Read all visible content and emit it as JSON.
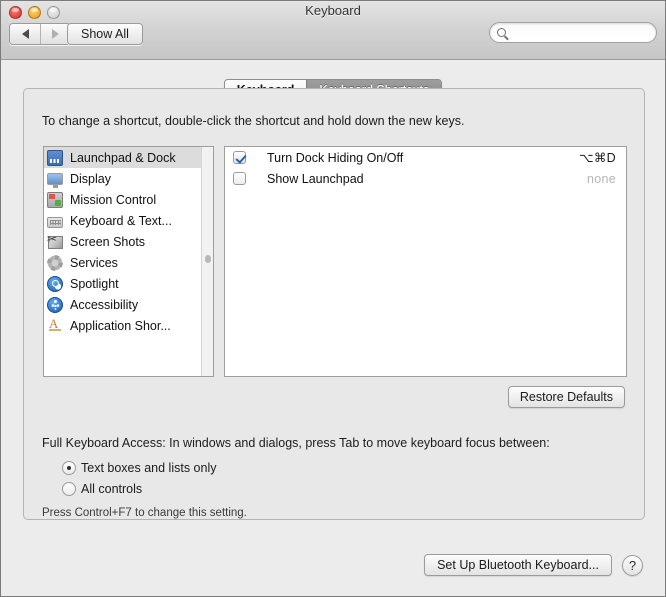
{
  "window": {
    "title": "Keyboard",
    "traffic_lights": [
      "close",
      "minimize",
      "zoom"
    ]
  },
  "toolbar": {
    "back_label": "◀",
    "forward_label": "▶",
    "show_all_label": "Show All",
    "search_value": "",
    "search_placeholder": ""
  },
  "tabs": [
    {
      "label": "Keyboard",
      "selected": false
    },
    {
      "label": "Keyboard Shortcuts",
      "selected": true
    }
  ],
  "main": {
    "hint": "To change a shortcut, double-click the shortcut and hold down the new keys.",
    "restore_defaults_label": "Restore Defaults"
  },
  "sidebar": {
    "items": [
      {
        "label": "Launchpad & Dock",
        "icon": "dock-icon",
        "selected": true
      },
      {
        "label": "Display",
        "icon": "display-icon",
        "selected": false
      },
      {
        "label": "Mission Control",
        "icon": "mission-control-icon",
        "selected": false
      },
      {
        "label": "Keyboard & Text...",
        "icon": "keyboard-icon",
        "selected": false
      },
      {
        "label": "Screen Shots",
        "icon": "screenshot-icon",
        "selected": false
      },
      {
        "label": "Services",
        "icon": "gear-icon",
        "selected": false
      },
      {
        "label": "Spotlight",
        "icon": "spotlight-icon",
        "selected": false
      },
      {
        "label": "Accessibility",
        "icon": "accessibility-icon",
        "selected": false
      },
      {
        "label": "Application Shor...",
        "icon": "application-shortcuts-icon",
        "selected": false
      }
    ]
  },
  "shortcuts": {
    "rows": [
      {
        "name": "Turn Dock Hiding On/Off",
        "combo": "⌥⌘D",
        "checked": true,
        "is_none": false
      },
      {
        "name": "Show Launchpad",
        "combo": "none",
        "checked": false,
        "is_none": true
      }
    ]
  },
  "full_keyboard_access": {
    "description": "Full Keyboard Access: In windows and dialogs, press Tab to move keyboard focus between:",
    "options": [
      {
        "label": "Text boxes and lists only",
        "selected": true
      },
      {
        "label": "All controls",
        "selected": false
      }
    ],
    "note": "Press Control+F7 to change this setting."
  },
  "footer": {
    "bluetooth_label": "Set Up Bluetooth Keyboard...",
    "help_label": "?"
  },
  "colors": {
    "accent": "#2c62b5",
    "selection": "#dcdcdc",
    "window_bg": "#ececec",
    "panel_bg": "#e8e8e8",
    "disabled_text": "#b5b5b5"
  }
}
